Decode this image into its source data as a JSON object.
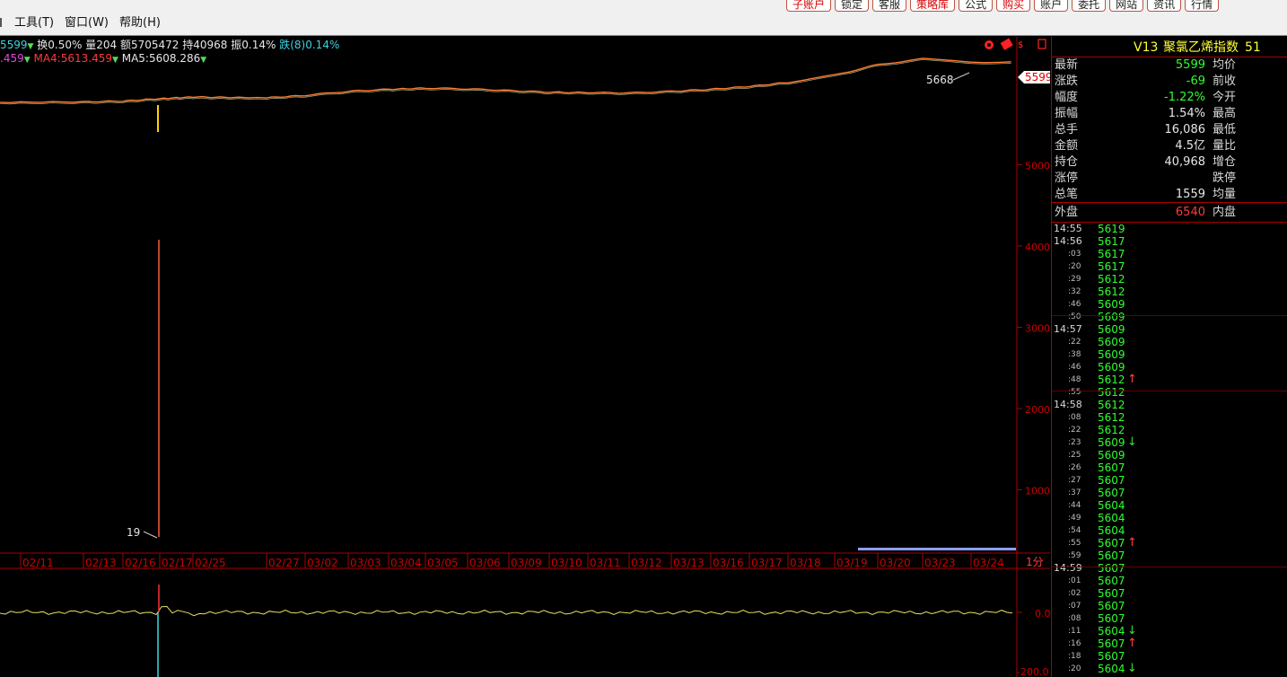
{
  "menu": {
    "tools": "工具(T)",
    "window": "窗口(W)",
    "help": "帮助(H)"
  },
  "top_buttons": [
    {
      "label": "子账户",
      "color": "red"
    },
    {
      "label": "锁定",
      "color": "dark"
    },
    {
      "label": "客服",
      "color": "dark"
    },
    {
      "label": "策略库",
      "color": "red"
    },
    {
      "label": "公式",
      "color": "dark"
    },
    {
      "label": "购买",
      "color": "red"
    },
    {
      "label": "账户",
      "color": "dark"
    },
    {
      "label": "委托",
      "color": "dark"
    },
    {
      "label": "网站",
      "color": "dark"
    },
    {
      "label": "资讯",
      "color": "dark"
    },
    {
      "label": "行情",
      "color": "dark"
    }
  ],
  "info": {
    "price_frag": "5599",
    "turnover": "换0.50%",
    "volume": "量204",
    "amount": "额5705472",
    "hold": "持40968",
    "amplitude": "振0.14%",
    "fall": "跌(8)0.14%",
    "ma3_frag": ".459",
    "ma4": "MA4:5613.459",
    "ma5": "MA5:5608.286"
  },
  "chart": {
    "price_ticks": [
      "5000",
      "4000",
      "3000",
      "2000",
      "1000"
    ],
    "current_price": "5599",
    "high_label": "5668",
    "low_label": "19",
    "sub_ticks": [
      "0.0",
      "-200.0"
    ],
    "period": "1分",
    "dates": [
      "02/11",
      "02/13",
      "02/16",
      "02/17",
      "02/25",
      "02/27",
      "03/02",
      "03/03",
      "03/04",
      "03/05",
      "03/06",
      "03/09",
      "03/10",
      "03/11",
      "03/12",
      "03/13",
      "03/16",
      "03/17",
      "03/18",
      "03/19",
      "03/20",
      "03/23",
      "03/24"
    ]
  },
  "chart_data": {
    "type": "line",
    "series": [
      {
        "values": [
          5105,
          5110,
          5120,
          5150,
          5170,
          5160,
          5190,
          5240,
          5265,
          5280,
          5270,
          5250,
          5230,
          5225,
          5220,
          5240,
          5265,
          5300,
          5350,
          5440,
          5568,
          5640,
          5599
        ]
      }
    ],
    "x": [
      "02/11",
      "02/13",
      "02/16",
      "02/17",
      "02/25",
      "02/27",
      "03/02",
      "03/03",
      "03/04",
      "03/05",
      "03/06",
      "03/09",
      "03/10",
      "03/11",
      "03/12",
      "03/13",
      "03/16",
      "03/17",
      "03/18",
      "03/19",
      "03/20",
      "03/23",
      "03/24"
    ],
    "ylim": [
      0,
      5800
    ]
  },
  "quote": {
    "version": "V13",
    "name": "聚氯乙烯指数",
    "code": "51",
    "rows": [
      {
        "label": "最新",
        "value": "5599",
        "color": "#2fff2f",
        "label2": "均价"
      },
      {
        "label": "涨跌",
        "value": "-69",
        "color": "#2fff2f",
        "label2": "前收"
      },
      {
        "label": "幅度",
        "value": "-1.22%",
        "color": "#2fff2f",
        "label2": "今开"
      },
      {
        "label": "振幅",
        "value": "1.54%",
        "color": "#e6e6e6",
        "label2": "最高"
      },
      {
        "label": "总手",
        "value": "16,086",
        "color": "#e6e6e6",
        "label2": "最低"
      },
      {
        "label": "金额",
        "value": "4.5亿",
        "color": "#e6e6e6",
        "label2": "量比"
      },
      {
        "label": "持仓",
        "value": "40,968",
        "color": "#e6e6e6",
        "label2": "增仓"
      },
      {
        "label": "涨停",
        "value": "",
        "color": "#e6e6e6",
        "label2": "跌停"
      },
      {
        "label": "总笔",
        "value": "1559",
        "color": "#e6e6e6",
        "label2": "均量"
      }
    ],
    "outer": {
      "label": "外盘",
      "value": "6540",
      "label2": "内盘"
    }
  },
  "ticks": [
    {
      "t": "14:55",
      "p": "5619",
      "a": ""
    },
    {
      "t": "14:56",
      "p": "5617",
      "a": ""
    },
    {
      "t": ":03",
      "p": "5617",
      "a": ""
    },
    {
      "t": ":20",
      "p": "5617",
      "a": ""
    },
    {
      "t": ":29",
      "p": "5612",
      "a": ""
    },
    {
      "t": ":32",
      "p": "5612",
      "a": ""
    },
    {
      "t": ":46",
      "p": "5609",
      "a": ""
    },
    {
      "t": ":50",
      "p": "5609",
      "a": ""
    },
    {
      "t": "14:57",
      "p": "5609",
      "a": ""
    },
    {
      "t": ":22",
      "p": "5609",
      "a": ""
    },
    {
      "t": ":38",
      "p": "5609",
      "a": ""
    },
    {
      "t": ":46",
      "p": "5609",
      "a": ""
    },
    {
      "t": ":48",
      "p": "5612",
      "a": "up"
    },
    {
      "t": ":55",
      "p": "5612",
      "a": ""
    },
    {
      "t": "14:58",
      "p": "5612",
      "a": ""
    },
    {
      "t": ":08",
      "p": "5612",
      "a": ""
    },
    {
      "t": ":22",
      "p": "5612",
      "a": ""
    },
    {
      "t": ":23",
      "p": "5609",
      "a": "down"
    },
    {
      "t": ":25",
      "p": "5609",
      "a": ""
    },
    {
      "t": ":26",
      "p": "5607",
      "a": ""
    },
    {
      "t": ":27",
      "p": "5607",
      "a": ""
    },
    {
      "t": ":37",
      "p": "5607",
      "a": ""
    },
    {
      "t": ":44",
      "p": "5604",
      "a": ""
    },
    {
      "t": ":49",
      "p": "5604",
      "a": ""
    },
    {
      "t": ":54",
      "p": "5604",
      "a": ""
    },
    {
      "t": ":55",
      "p": "5607",
      "a": "up"
    },
    {
      "t": ":59",
      "p": "5607",
      "a": ""
    },
    {
      "t": "14:59",
      "p": "5607",
      "a": ""
    },
    {
      "t": ":01",
      "p": "5607",
      "a": ""
    },
    {
      "t": ":02",
      "p": "5607",
      "a": ""
    },
    {
      "t": ":07",
      "p": "5607",
      "a": ""
    },
    {
      "t": ":08",
      "p": "5607",
      "a": ""
    },
    {
      "t": ":11",
      "p": "5604",
      "a": "down"
    },
    {
      "t": ":16",
      "p": "5607",
      "a": "up"
    },
    {
      "t": ":18",
      "p": "5607",
      "a": ""
    },
    {
      "t": ":20",
      "p": "5604",
      "a": "down"
    }
  ]
}
